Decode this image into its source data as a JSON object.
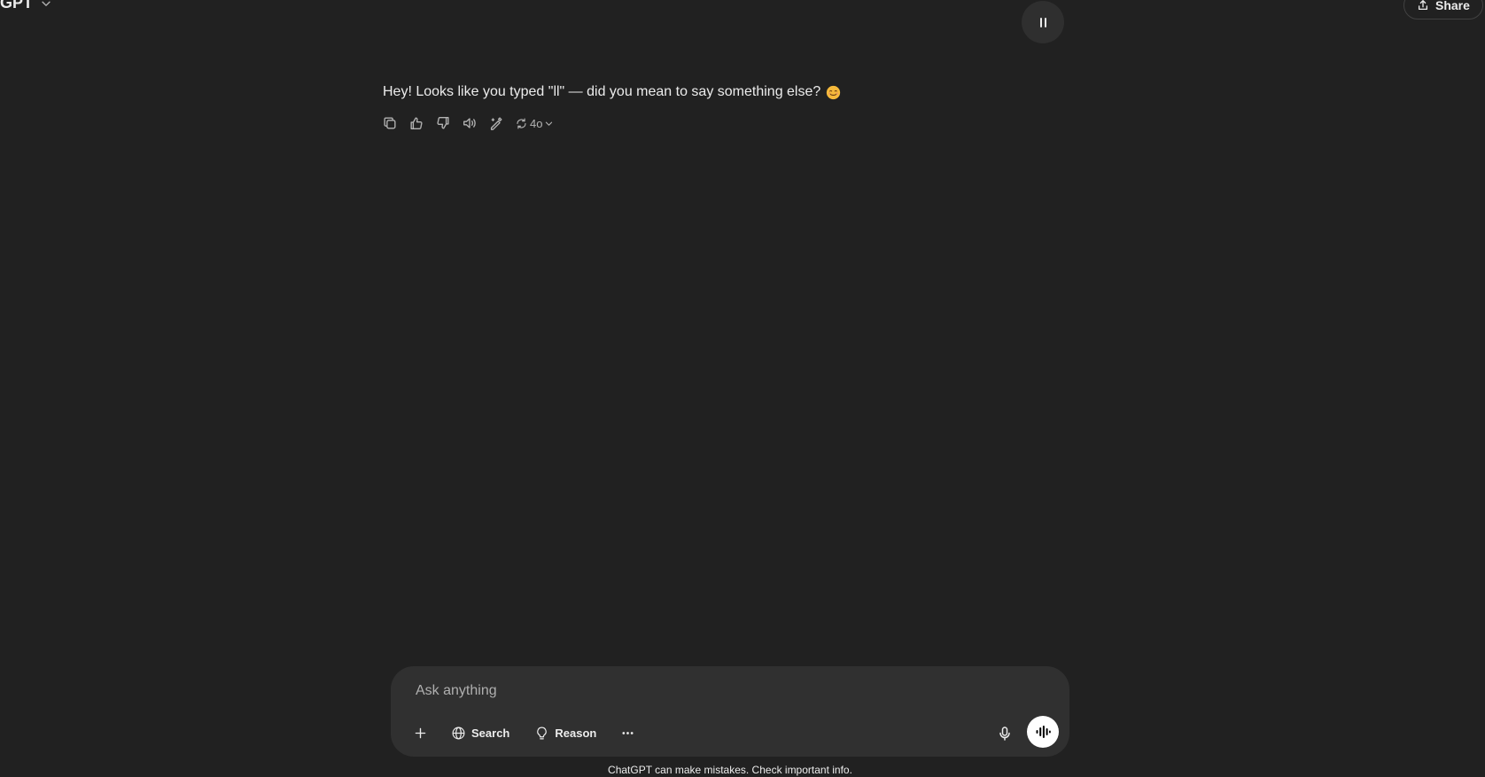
{
  "header": {
    "model_name": "tGPT",
    "share_label": "Share"
  },
  "message": {
    "text": "Hey! Looks like you typed \"ll\" — did you mean to say something else?",
    "emoji": "smiling-face-emoji"
  },
  "message_actions": {
    "model_label": "4o"
  },
  "composer": {
    "placeholder": "Ask anything",
    "search_label": "Search",
    "reason_label": "Reason"
  },
  "footer": {
    "disclaimer": "ChatGPT can make mistakes. Check important info."
  },
  "colors": {
    "background": "#212121",
    "composer": "#303030",
    "text": "#ececec",
    "muted": "#b4b4b4"
  }
}
